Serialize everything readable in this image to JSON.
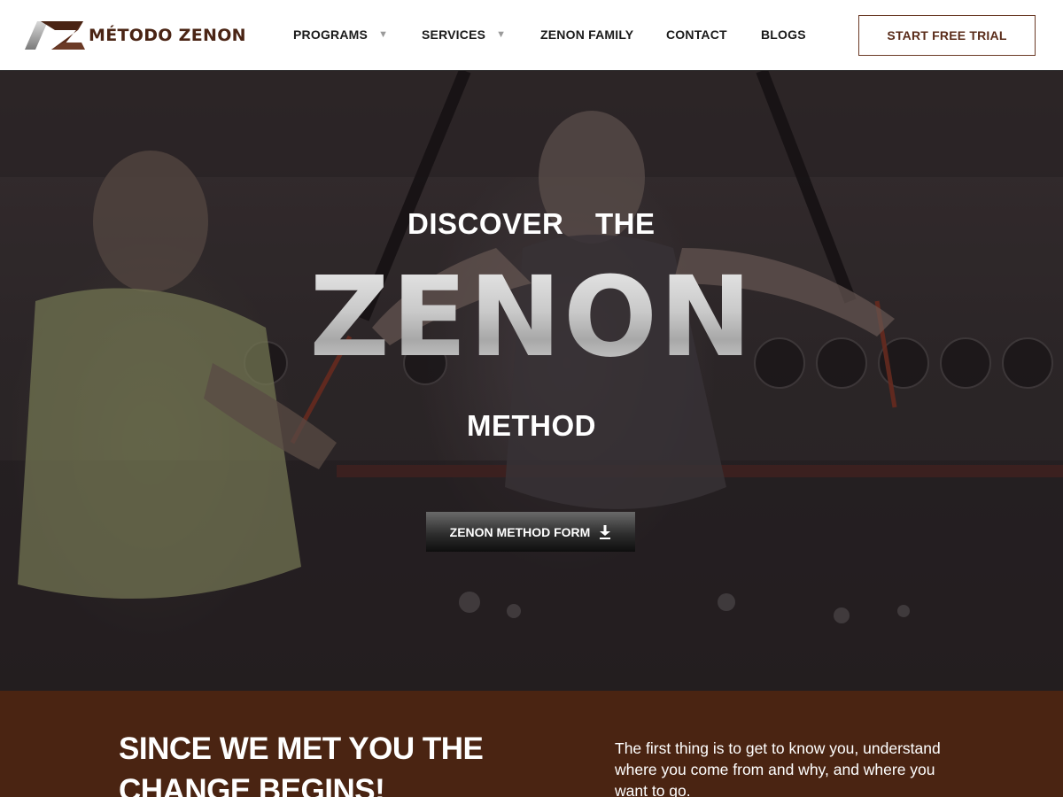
{
  "brand": {
    "name": "MÉTODO ZENON",
    "colors": {
      "primary": "#4a2414",
      "accent": "#6b3a26",
      "band": "#4a2412"
    }
  },
  "nav": {
    "items": [
      {
        "label": "PROGRAMS",
        "has_dropdown": true
      },
      {
        "label": "SERVICES",
        "has_dropdown": true
      },
      {
        "label": "ZENON FAMILY",
        "has_dropdown": false
      },
      {
        "label": "CONTACT",
        "has_dropdown": false
      },
      {
        "label": "BLOGS",
        "has_dropdown": false
      }
    ],
    "dropdown_caret": "▼",
    "cta_label": "START FREE TRIAL"
  },
  "hero": {
    "line1_word1": "DISCOVER",
    "line1_word2": "THE",
    "headline": "ZENON",
    "line3": "METHOD",
    "button_label": "ZENON METHOD FORM",
    "button_icon": "download-icon"
  },
  "intro": {
    "title": "SINCE WE MET YOU THE CHANGE BEGINS!",
    "text": "The first thing is to get to know you, understand where you come from and why, and where you want to go."
  }
}
